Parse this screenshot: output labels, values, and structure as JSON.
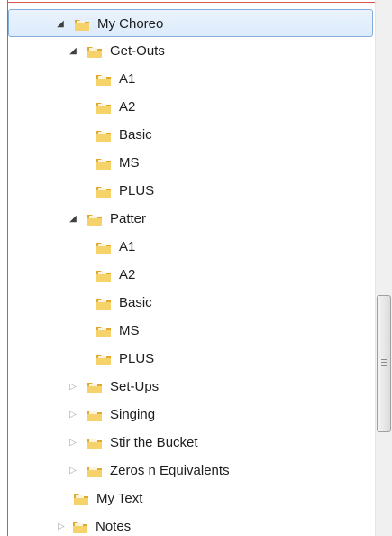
{
  "tree": {
    "items": [
      {
        "label": "My Choreo",
        "expanded": true,
        "has_children": true,
        "selected": true
      },
      {
        "label": "Get-Outs",
        "expanded": true,
        "has_children": true
      },
      {
        "label": "A1",
        "has_children": false
      },
      {
        "label": "A2",
        "has_children": false
      },
      {
        "label": "Basic",
        "has_children": false
      },
      {
        "label": "MS",
        "has_children": false
      },
      {
        "label": "PLUS",
        "has_children": false
      },
      {
        "label": "Patter",
        "expanded": true,
        "has_children": true
      },
      {
        "label": "A1",
        "has_children": false
      },
      {
        "label": "A2",
        "has_children": false
      },
      {
        "label": "Basic",
        "has_children": false
      },
      {
        "label": "MS",
        "has_children": false
      },
      {
        "label": "PLUS",
        "has_children": false
      },
      {
        "label": "Set-Ups",
        "expanded": false,
        "has_children": true
      },
      {
        "label": "Singing",
        "expanded": false,
        "has_children": true
      },
      {
        "label": "Stir the Bucket",
        "expanded": false,
        "has_children": true
      },
      {
        "label": "Zeros n Equivalents",
        "expanded": false,
        "has_children": true
      },
      {
        "label": "My Text",
        "has_children": false
      },
      {
        "label": "Notes",
        "expanded": false,
        "has_children": true
      }
    ]
  },
  "icons": {
    "expanded_arrow": "expanded-triangle-icon",
    "collapsed_arrow": "collapsed-triangle-icon",
    "folder": "folder-icon"
  },
  "colors": {
    "selection_border": "#84acdd",
    "selection_fill": "#dcebfc",
    "folder_yellow": "#f2c94c",
    "frame_red": "#d9534f"
  }
}
